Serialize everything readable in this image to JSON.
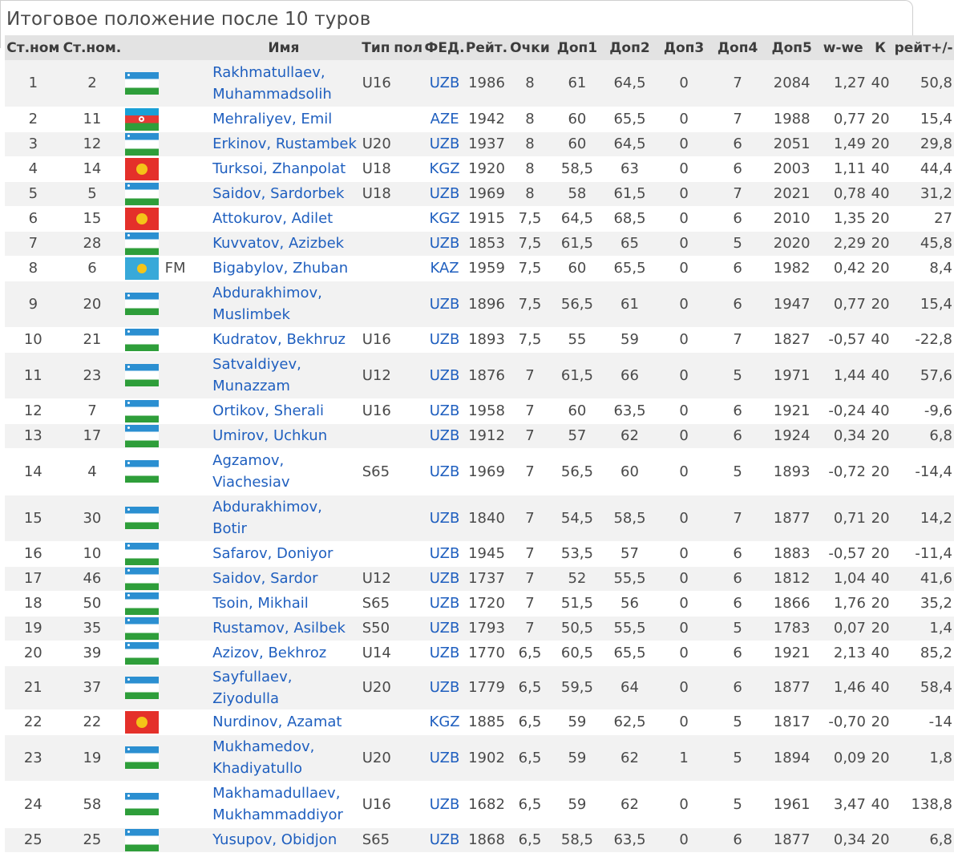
{
  "title": "Итоговое положение после 10 туров",
  "columns": [
    "Ст.ном",
    "Ст.ном.",
    "",
    "",
    "Имя",
    "Тип",
    "пол",
    "ФЕД.",
    "Рейт.",
    "Очки",
    "Доп1",
    "Доп2",
    "Доп3",
    "Доп4",
    "Доп5",
    "w-we",
    "К",
    "рейт+/-"
  ],
  "rows": [
    {
      "rank": "1",
      "sno": "2",
      "flag": "uzb",
      "title": "",
      "name": "Rakhmatullaev, Muhammadsolih",
      "type": "U16",
      "fed": "UZB",
      "rtg": "1986",
      "pts": "8",
      "t1": "61",
      "t2": "64,5",
      "t3": "0",
      "t4": "7",
      "t5": "2084",
      "wwe": "1,27",
      "k": "40",
      "delta": "50,8",
      "tall": true
    },
    {
      "rank": "2",
      "sno": "11",
      "flag": "aze",
      "title": "",
      "name": "Mehraliyev, Emil",
      "type": "",
      "fed": "AZE",
      "rtg": "1942",
      "pts": "8",
      "t1": "60",
      "t2": "65,5",
      "t3": "0",
      "t4": "7",
      "t5": "1988",
      "wwe": "0,77",
      "k": "20",
      "delta": "15,4",
      "tall": false
    },
    {
      "rank": "3",
      "sno": "12",
      "flag": "uzb",
      "title": "",
      "name": "Erkinov, Rustambek",
      "type": "U20",
      "fed": "UZB",
      "rtg": "1937",
      "pts": "8",
      "t1": "60",
      "t2": "64,5",
      "t3": "0",
      "t4": "6",
      "t5": "2051",
      "wwe": "1,49",
      "k": "20",
      "delta": "29,8",
      "tall": false
    },
    {
      "rank": "4",
      "sno": "14",
      "flag": "kgz",
      "title": "",
      "name": "Turksoi, Zhanpolat",
      "type": "U18",
      "fed": "KGZ",
      "rtg": "1920",
      "pts": "8",
      "t1": "58,5",
      "t2": "63",
      "t3": "0",
      "t4": "6",
      "t5": "2003",
      "wwe": "1,11",
      "k": "40",
      "delta": "44,4",
      "tall": false
    },
    {
      "rank": "5",
      "sno": "5",
      "flag": "uzb",
      "title": "",
      "name": "Saidov, Sardorbek",
      "type": "U18",
      "fed": "UZB",
      "rtg": "1969",
      "pts": "8",
      "t1": "58",
      "t2": "61,5",
      "t3": "0",
      "t4": "7",
      "t5": "2021",
      "wwe": "0,78",
      "k": "40",
      "delta": "31,2",
      "tall": false
    },
    {
      "rank": "6",
      "sno": "15",
      "flag": "kgz",
      "title": "",
      "name": "Attokurov, Adilet",
      "type": "",
      "fed": "KGZ",
      "rtg": "1915",
      "pts": "7,5",
      "t1": "64,5",
      "t2": "68,5",
      "t3": "0",
      "t4": "6",
      "t5": "2010",
      "wwe": "1,35",
      "k": "20",
      "delta": "27",
      "tall": false
    },
    {
      "rank": "7",
      "sno": "28",
      "flag": "uzb",
      "title": "",
      "name": "Kuvvatov, Azizbek",
      "type": "",
      "fed": "UZB",
      "rtg": "1853",
      "pts": "7,5",
      "t1": "61,5",
      "t2": "65",
      "t3": "0",
      "t4": "5",
      "t5": "2020",
      "wwe": "2,29",
      "k": "20",
      "delta": "45,8",
      "tall": false
    },
    {
      "rank": "8",
      "sno": "6",
      "flag": "kaz",
      "title": "FM",
      "name": "Bigabylov, Zhuban",
      "type": "",
      "fed": "KAZ",
      "rtg": "1959",
      "pts": "7,5",
      "t1": "60",
      "t2": "65,5",
      "t3": "0",
      "t4": "6",
      "t5": "1982",
      "wwe": "0,42",
      "k": "20",
      "delta": "8,4",
      "tall": false
    },
    {
      "rank": "9",
      "sno": "20",
      "flag": "uzb",
      "title": "",
      "name": "Abdurakhimov, Muslimbek",
      "type": "",
      "fed": "UZB",
      "rtg": "1896",
      "pts": "7,5",
      "t1": "56,5",
      "t2": "61",
      "t3": "0",
      "t4": "6",
      "t5": "1947",
      "wwe": "0,77",
      "k": "20",
      "delta": "15,4",
      "tall": true
    },
    {
      "rank": "10",
      "sno": "21",
      "flag": "uzb",
      "title": "",
      "name": "Kudratov, Bekhruz",
      "type": "U16",
      "fed": "UZB",
      "rtg": "1893",
      "pts": "7,5",
      "t1": "55",
      "t2": "59",
      "t3": "0",
      "t4": "7",
      "t5": "1827",
      "wwe": "-0,57",
      "k": "40",
      "delta": "-22,8",
      "tall": false
    },
    {
      "rank": "11",
      "sno": "23",
      "flag": "uzb",
      "title": "",
      "name": "Satvaldiyev, Munazzam",
      "type": "U12",
      "fed": "UZB",
      "rtg": "1876",
      "pts": "7",
      "t1": "61,5",
      "t2": "66",
      "t3": "0",
      "t4": "5",
      "t5": "1971",
      "wwe": "1,44",
      "k": "40",
      "delta": "57,6",
      "tall": true
    },
    {
      "rank": "12",
      "sno": "7",
      "flag": "uzb",
      "title": "",
      "name": "Ortikov, Sherali",
      "type": "U16",
      "fed": "UZB",
      "rtg": "1958",
      "pts": "7",
      "t1": "60",
      "t2": "63,5",
      "t3": "0",
      "t4": "6",
      "t5": "1921",
      "wwe": "-0,24",
      "k": "40",
      "delta": "-9,6",
      "tall": false
    },
    {
      "rank": "13",
      "sno": "17",
      "flag": "uzb",
      "title": "",
      "name": "Umirov, Uchkun",
      "type": "",
      "fed": "UZB",
      "rtg": "1912",
      "pts": "7",
      "t1": "57",
      "t2": "62",
      "t3": "0",
      "t4": "6",
      "t5": "1924",
      "wwe": "0,34",
      "k": "20",
      "delta": "6,8",
      "tall": false
    },
    {
      "rank": "14",
      "sno": "4",
      "flag": "uzb",
      "title": "",
      "name": "Agzamov, Viachesiav",
      "type": "S65",
      "fed": "UZB",
      "rtg": "1969",
      "pts": "7",
      "t1": "56,5",
      "t2": "60",
      "t3": "0",
      "t4": "5",
      "t5": "1893",
      "wwe": "-0,72",
      "k": "20",
      "delta": "-14,4",
      "tall": true
    },
    {
      "rank": "15",
      "sno": "30",
      "flag": "uzb",
      "title": "",
      "name": "Abdurakhimov, Botir",
      "type": "",
      "fed": "UZB",
      "rtg": "1840",
      "pts": "7",
      "t1": "54,5",
      "t2": "58,5",
      "t3": "0",
      "t4": "7",
      "t5": "1877",
      "wwe": "0,71",
      "k": "20",
      "delta": "14,2",
      "tall": true
    },
    {
      "rank": "16",
      "sno": "10",
      "flag": "uzb",
      "title": "",
      "name": "Safarov, Doniyor",
      "type": "",
      "fed": "UZB",
      "rtg": "1945",
      "pts": "7",
      "t1": "53,5",
      "t2": "57",
      "t3": "0",
      "t4": "6",
      "t5": "1883",
      "wwe": "-0,57",
      "k": "20",
      "delta": "-11,4",
      "tall": false
    },
    {
      "rank": "17",
      "sno": "46",
      "flag": "uzb",
      "title": "",
      "name": "Saidov, Sardor",
      "type": "U12",
      "fed": "UZB",
      "rtg": "1737",
      "pts": "7",
      "t1": "52",
      "t2": "55,5",
      "t3": "0",
      "t4": "6",
      "t5": "1812",
      "wwe": "1,04",
      "k": "40",
      "delta": "41,6",
      "tall": false
    },
    {
      "rank": "18",
      "sno": "50",
      "flag": "uzb",
      "title": "",
      "name": "Tsoin, Mikhail",
      "type": "S65",
      "fed": "UZB",
      "rtg": "1720",
      "pts": "7",
      "t1": "51,5",
      "t2": "56",
      "t3": "0",
      "t4": "6",
      "t5": "1866",
      "wwe": "1,76",
      "k": "20",
      "delta": "35,2",
      "tall": false
    },
    {
      "rank": "19",
      "sno": "35",
      "flag": "uzb",
      "title": "",
      "name": "Rustamov, Asilbek",
      "type": "S50",
      "fed": "UZB",
      "rtg": "1793",
      "pts": "7",
      "t1": "50,5",
      "t2": "55,5",
      "t3": "0",
      "t4": "5",
      "t5": "1783",
      "wwe": "0,07",
      "k": "20",
      "delta": "1,4",
      "tall": false
    },
    {
      "rank": "20",
      "sno": "39",
      "flag": "uzb",
      "title": "",
      "name": "Azizov, Bekhroz",
      "type": "U14",
      "fed": "UZB",
      "rtg": "1770",
      "pts": "6,5",
      "t1": "60,5",
      "t2": "65,5",
      "t3": "0",
      "t4": "6",
      "t5": "1921",
      "wwe": "2,13",
      "k": "40",
      "delta": "85,2",
      "tall": false
    },
    {
      "rank": "21",
      "sno": "37",
      "flag": "uzb",
      "title": "",
      "name": "Sayfullaev, Ziyodulla",
      "type": "U20",
      "fed": "UZB",
      "rtg": "1779",
      "pts": "6,5",
      "t1": "59,5",
      "t2": "64",
      "t3": "0",
      "t4": "6",
      "t5": "1877",
      "wwe": "1,46",
      "k": "40",
      "delta": "58,4",
      "tall": false
    },
    {
      "rank": "22",
      "sno": "22",
      "flag": "kgz",
      "title": "",
      "name": "Nurdinov, Azamat",
      "type": "",
      "fed": "KGZ",
      "rtg": "1885",
      "pts": "6,5",
      "t1": "59",
      "t2": "62,5",
      "t3": "0",
      "t4": "5",
      "t5": "1817",
      "wwe": "-0,70",
      "k": "20",
      "delta": "-14",
      "tall": false
    },
    {
      "rank": "23",
      "sno": "19",
      "flag": "uzb",
      "title": "",
      "name": "Mukhamedov, Khadiyatullo",
      "type": "U20",
      "fed": "UZB",
      "rtg": "1902",
      "pts": "6,5",
      "t1": "59",
      "t2": "62",
      "t3": "1",
      "t4": "5",
      "t5": "1894",
      "wwe": "0,09",
      "k": "20",
      "delta": "1,8",
      "tall": true
    },
    {
      "rank": "24",
      "sno": "58",
      "flag": "uzb",
      "title": "",
      "name": "Makhamadullaev, Mukhammaddiyor",
      "type": "U16",
      "fed": "UZB",
      "rtg": "1682",
      "pts": "6,5",
      "t1": "59",
      "t2": "62",
      "t3": "0",
      "t4": "5",
      "t5": "1961",
      "wwe": "3,47",
      "k": "40",
      "delta": "138,8",
      "tall": true
    },
    {
      "rank": "25",
      "sno": "25",
      "flag": "uzb",
      "title": "",
      "name": "Yusupov, Obidjon",
      "type": "S65",
      "fed": "UZB",
      "rtg": "1868",
      "pts": "6,5",
      "t1": "58,5",
      "t2": "63,5",
      "t3": "0",
      "t4": "6",
      "t5": "1877",
      "wwe": "0,34",
      "k": "20",
      "delta": "6,8",
      "tall": false
    }
  ]
}
